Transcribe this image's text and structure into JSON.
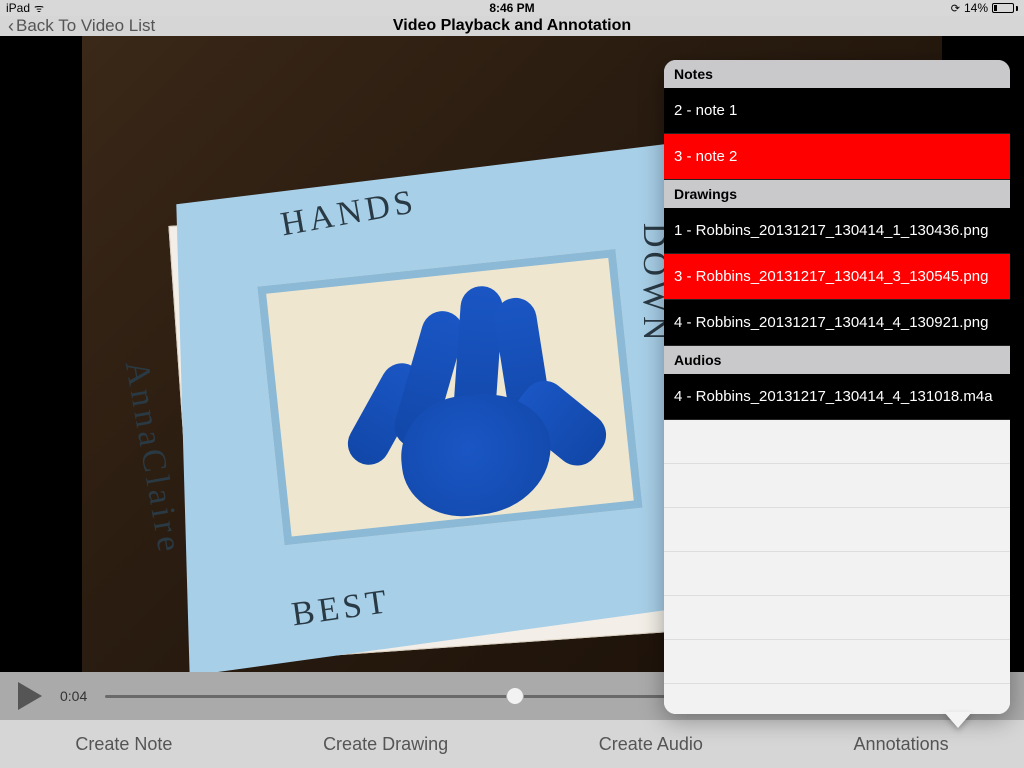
{
  "status": {
    "device": "iPad",
    "time": "8:46 PM",
    "battery_pct": "14%",
    "lock_glyph": "⟳",
    "wifi_glyph": "ᯤ"
  },
  "nav": {
    "back_glyph": "‹",
    "back_label": "Back To Video List",
    "title": "Video Playback and Annotation"
  },
  "craft": {
    "top": "HANDS",
    "left": "AnnaClaire",
    "right": "DOWN",
    "bottom": "BEST"
  },
  "playback": {
    "time": "0:04"
  },
  "toolbar": {
    "create_note": "Create Note",
    "create_drawing": "Create Drawing",
    "create_audio": "Create Audio",
    "annotations": "Annotations"
  },
  "annotations": {
    "notes_header": "Notes",
    "notes": [
      {
        "label": "2 - note 1",
        "selected": false
      },
      {
        "label": "3 - note 2",
        "selected": true
      }
    ],
    "drawings_header": "Drawings",
    "drawings": [
      {
        "label": "1 - Robbins_20131217_130414_1_130436.png",
        "selected": false
      },
      {
        "label": "3 - Robbins_20131217_130414_3_130545.png",
        "selected": true
      },
      {
        "label": "4 - Robbins_20131217_130414_4_130921.png",
        "selected": false
      }
    ],
    "audios_header": "Audios",
    "audios": [
      {
        "label": "4 - Robbins_20131217_130414_4_131018.m4a",
        "selected": false
      }
    ]
  }
}
